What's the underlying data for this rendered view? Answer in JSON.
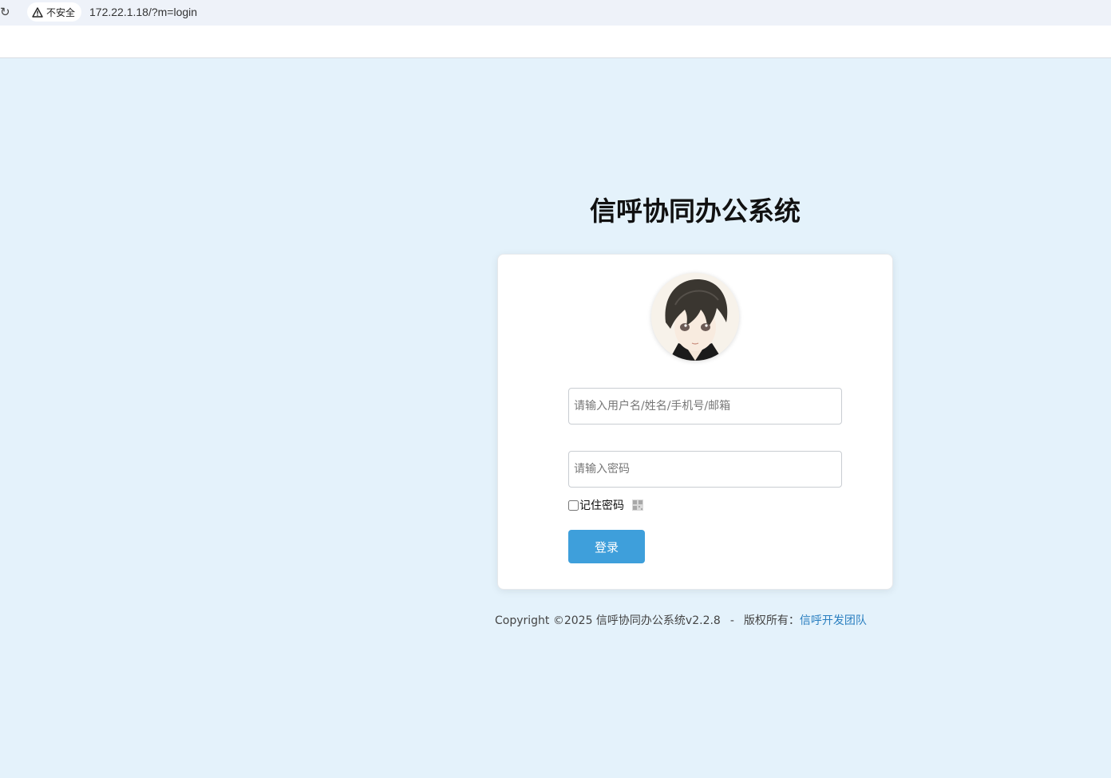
{
  "browser": {
    "security_label": "不安全",
    "url": "172.22.1.18/?m=login"
  },
  "login": {
    "title": "信呼协同办公系统",
    "username_placeholder": "请输入用户名/姓名/手机号/邮箱",
    "password_placeholder": "请输入密码",
    "remember_label": "记住密码",
    "submit_label": "登录"
  },
  "footer": {
    "copyright": "Copyright ©2025 信呼协同办公系统v2.2.8",
    "separator": "-",
    "rights_label": "版权所有：",
    "team_link": "信呼开发团队"
  },
  "colors": {
    "page_background": "#e4f2fb",
    "primary_button": "#3e9fdb",
    "link": "#2a7fc0"
  },
  "icons": [
    "reload-icon",
    "warning-icon",
    "avatar",
    "qr-code-icon"
  ]
}
